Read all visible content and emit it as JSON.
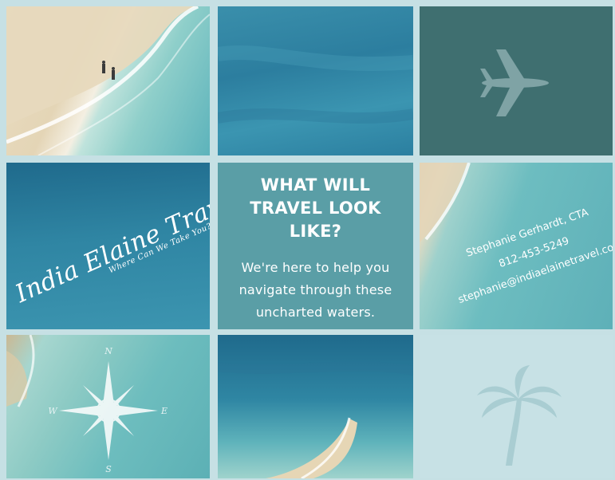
{
  "headline": {
    "line1": "WHAT WILL",
    "line2": "TRAVEL LOOK",
    "line3": "LIKE?"
  },
  "message": {
    "line1": "We're here to help you",
    "line2": "navigate through these",
    "line3": "uncharted waters."
  },
  "brand": {
    "name": "India Elaine Travel",
    "tagline": "Where Can We Take You?"
  },
  "contact": {
    "name": "Stephanie Gerhardt, CTA",
    "phone": "812-453-5249",
    "email": "stephanie@indiaelainetravel.com"
  },
  "compass": {
    "n": "N",
    "s": "S",
    "e": "E",
    "w": "W"
  },
  "icons": [
    "airplane-icon",
    "compass-rose-icon",
    "palm-tree-icon"
  ],
  "colors": {
    "background": "#c6e0e4",
    "center_tile": "#5a9ea6",
    "airplane_tile": "#3f6f70",
    "palm_tile": "#c7e1e5",
    "text": "#ffffff"
  }
}
